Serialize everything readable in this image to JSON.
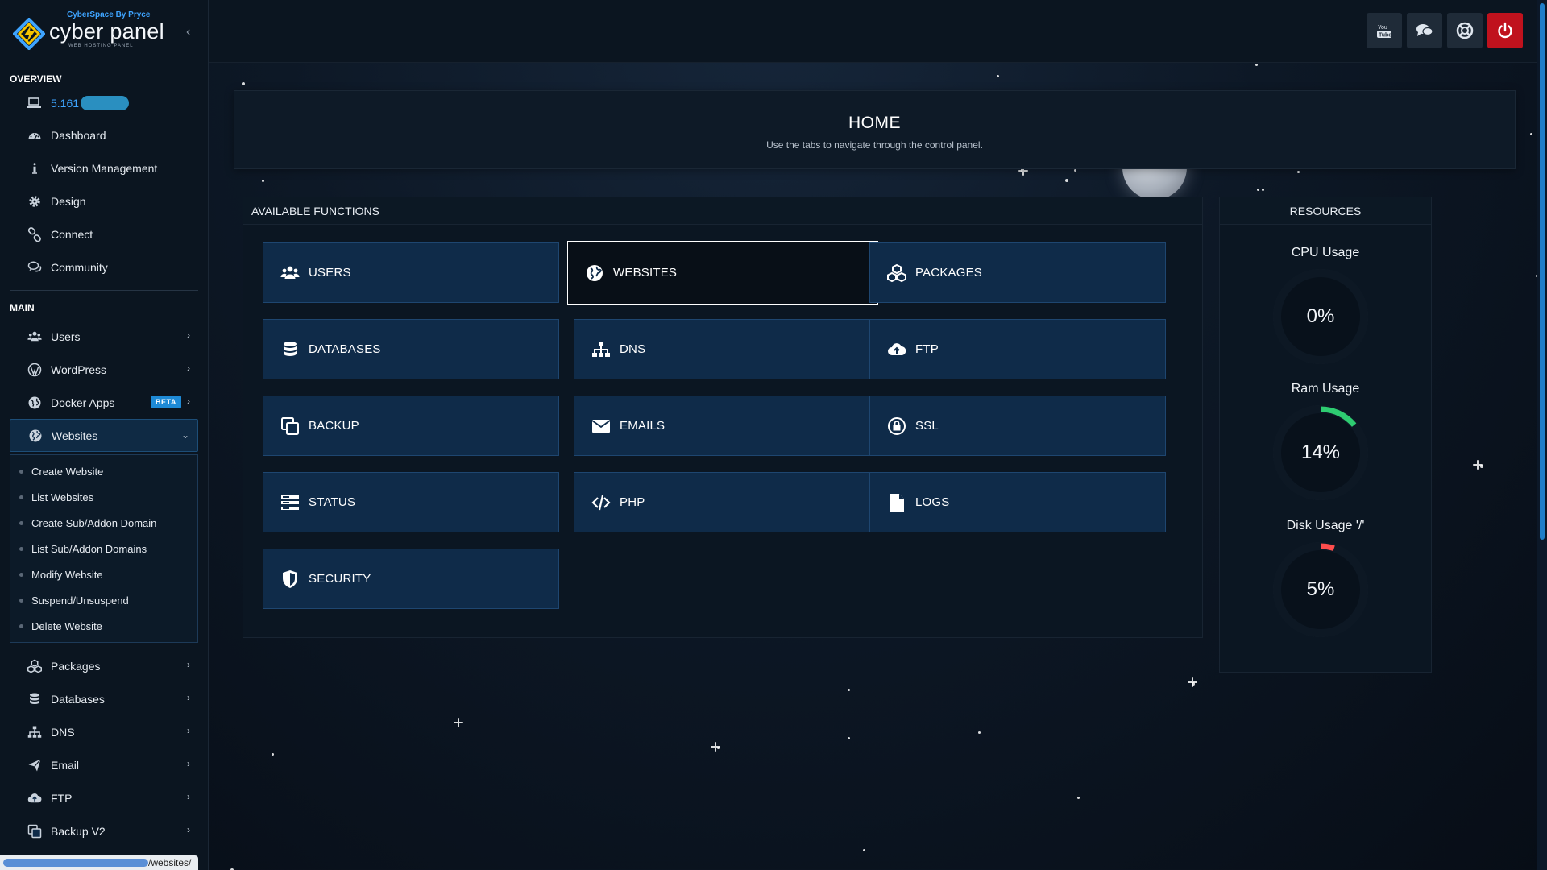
{
  "brand": {
    "by": "CyberSpace By Pryce",
    "name": "cyber panel",
    "tagline": "WEB HOSTING PANEL"
  },
  "sidebar": {
    "overview_title": "OVERVIEW",
    "version": "5.161",
    "overview_items": [
      {
        "label": "Dashboard",
        "icon": "dashboard-icon"
      },
      {
        "label": "Version Management",
        "icon": "info-icon"
      },
      {
        "label": "Design",
        "icon": "gear-icon"
      },
      {
        "label": "Connect",
        "icon": "link-icon"
      },
      {
        "label": "Community",
        "icon": "comments-icon"
      }
    ],
    "main_title": "MAIN",
    "main_items": [
      {
        "label": "Users",
        "icon": "users-icon"
      },
      {
        "label": "WordPress",
        "icon": "wordpress-icon"
      },
      {
        "label": "Docker Apps",
        "icon": "docker-icon",
        "badge": "BETA"
      },
      {
        "label": "Websites",
        "icon": "globe-icon",
        "expanded": true
      }
    ],
    "websites_sub": [
      "Create Website",
      "List Websites",
      "Create Sub/Addon Domain",
      "List Sub/Addon Domains",
      "Modify Website",
      "Suspend/Unsuspend",
      "Delete Website"
    ],
    "more_items": [
      {
        "label": "Packages",
        "icon": "cubes-icon"
      },
      {
        "label": "Databases",
        "icon": "database-icon"
      },
      {
        "label": "DNS",
        "icon": "sitemap-icon"
      },
      {
        "label": "Email",
        "icon": "paper-plane-icon"
      },
      {
        "label": "FTP",
        "icon": "cloud-upload-icon"
      },
      {
        "label": "Backup V2",
        "icon": "copy-icon"
      }
    ]
  },
  "statusbar": {
    "url_suffix": "/websites/"
  },
  "home": {
    "title": "HOME",
    "subtitle": "Use the tabs to navigate through the control panel."
  },
  "functions": {
    "title": "AVAILABLE FUNCTIONS",
    "items": [
      {
        "label": "USERS",
        "icon": "users-icon"
      },
      {
        "label": "WEBSITES",
        "icon": "globe-icon",
        "selected": true
      },
      {
        "label": "PACKAGES",
        "icon": "cubes-icon"
      },
      {
        "label": "DATABASES",
        "icon": "database-icon"
      },
      {
        "label": "DNS",
        "icon": "sitemap-icon"
      },
      {
        "label": "FTP",
        "icon": "cloud-upload-icon"
      },
      {
        "label": "BACKUP",
        "icon": "copy-icon"
      },
      {
        "label": "EMAILS",
        "icon": "envelope-icon"
      },
      {
        "label": "SSL",
        "icon": "lock-icon"
      },
      {
        "label": "STATUS",
        "icon": "server-icon"
      },
      {
        "label": "PHP",
        "icon": "code-icon"
      },
      {
        "label": "LOGS",
        "icon": "file-icon"
      },
      {
        "label": "SECURITY",
        "icon": "shield-icon"
      }
    ]
  },
  "resources": {
    "title": "RESOURCES",
    "gauges": [
      {
        "label": "CPU Usage",
        "value": "0%",
        "fraction": 0.0,
        "color": "#2ecc71"
      },
      {
        "label": "Ram Usage",
        "value": "14%",
        "fraction": 0.14,
        "color": "#2ecc71"
      },
      {
        "label": "Disk Usage '/'",
        "value": "5%",
        "fraction": 0.05,
        "color": "#ff4d4d"
      }
    ]
  },
  "topbar": {
    "buttons": [
      "youtube-icon",
      "chat-icon",
      "support-icon",
      "power-icon"
    ]
  },
  "colors": {
    "accent": "#3ea4ff",
    "tile": "#0f2b49",
    "power": "#c0121d"
  }
}
